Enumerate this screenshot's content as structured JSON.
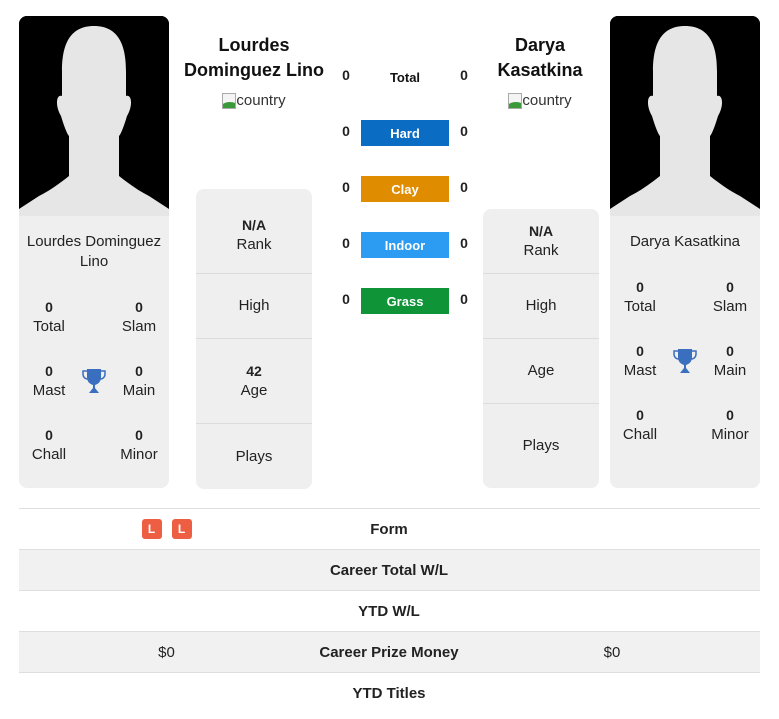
{
  "player1": {
    "name": "Lourdes Dominguez Lino",
    "name_line1": "Lourdes",
    "name_line2": "Dominguez Lino",
    "card_name": "Lourdes Dominguez Lino",
    "country_alt": "country",
    "titles": {
      "total": {
        "value": "0",
        "label": "Total"
      },
      "slam": {
        "value": "0",
        "label": "Slam"
      },
      "mast": {
        "value": "0",
        "label": "Mast"
      },
      "main": {
        "value": "0",
        "label": "Main"
      },
      "chall": {
        "value": "0",
        "label": "Chall"
      },
      "minor": {
        "value": "0",
        "label": "Minor"
      }
    },
    "rank": {
      "value": "N/A",
      "label": "Rank"
    },
    "high": {
      "value": "",
      "label": "High"
    },
    "age": {
      "value": "42",
      "label": "Age"
    },
    "plays": {
      "value": "",
      "label": "Plays"
    },
    "form": [
      "L",
      "L"
    ],
    "career_total_wl": "",
    "ytd_wl": "",
    "career_prize_money": "$0",
    "ytd_titles": ""
  },
  "player2": {
    "name": "Darya Kasatkina",
    "name_line1": "Darya",
    "name_line2": "Kasatkina",
    "card_name": "Darya Kasatkina",
    "country_alt": "country",
    "titles": {
      "total": {
        "value": "0",
        "label": "Total"
      },
      "slam": {
        "value": "0",
        "label": "Slam"
      },
      "mast": {
        "value": "0",
        "label": "Mast"
      },
      "main": {
        "value": "0",
        "label": "Main"
      },
      "chall": {
        "value": "0",
        "label": "Chall"
      },
      "minor": {
        "value": "0",
        "label": "Minor"
      }
    },
    "rank": {
      "value": "N/A",
      "label": "Rank"
    },
    "high": {
      "value": "",
      "label": "High"
    },
    "age": {
      "value": "",
      "label": "Age"
    },
    "plays": {
      "value": "",
      "label": "Plays"
    },
    "form": [],
    "career_total_wl": "",
    "ytd_wl": "",
    "career_prize_money": "$0",
    "ytd_titles": ""
  },
  "h2h": [
    {
      "surface": "Total",
      "p1": "0",
      "p2": "0",
      "color": ""
    },
    {
      "surface": "Hard",
      "p1": "0",
      "p2": "0",
      "color": "#0a6cc2"
    },
    {
      "surface": "Clay",
      "p1": "0",
      "p2": "0",
      "color": "#e08c00"
    },
    {
      "surface": "Indoor",
      "p1": "0",
      "p2": "0",
      "color": "#2b9cf2"
    },
    {
      "surface": "Grass",
      "p1": "0",
      "p2": "0",
      "color": "#0f9438"
    }
  ],
  "comparison": {
    "form_label": "Form",
    "career_total_wl_label": "Career Total W/L",
    "ytd_wl_label": "YTD W/L",
    "career_prize_money_label": "Career Prize Money",
    "ytd_titles_label": "YTD Titles"
  },
  "colors": {
    "loss_badge": "#ed5e42",
    "trophy": "#3a6fbf",
    "card_bg": "#efefef"
  }
}
